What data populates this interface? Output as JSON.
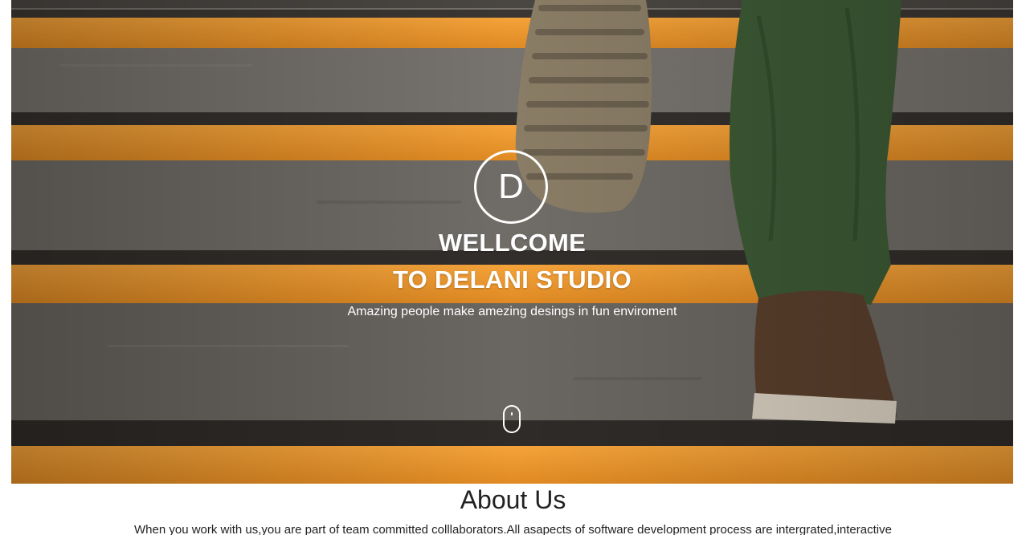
{
  "hero": {
    "logo_letter": "D",
    "title_line1": "WELLCOME",
    "title_line2": "TO DELANI STUDIO",
    "tagline": "Amazing people make amezing desings in fun enviroment",
    "background_icon": "scroll-mouse-icon"
  },
  "about": {
    "heading": "About Us",
    "text": "When you work with us,you are part of team committed colllaborators.All asapects of software development process are intergrated,interactive"
  },
  "colors": {
    "stair_orange": "#f19a2a",
    "stair_grey": "#6d6a66",
    "text_dark": "#222222",
    "hero_text": "#ffffff"
  }
}
